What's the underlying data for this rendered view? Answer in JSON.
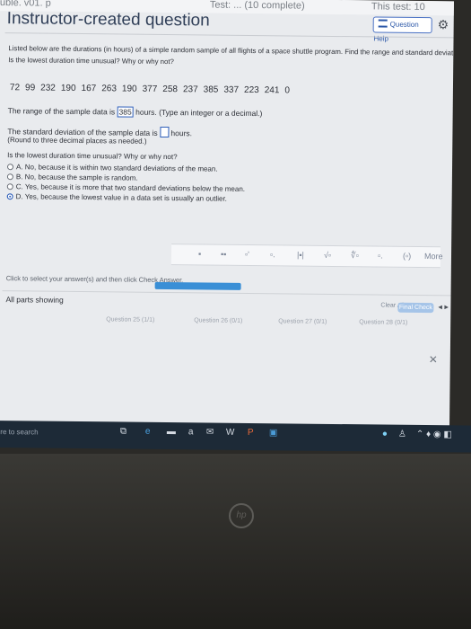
{
  "top": {
    "left": "uble. v01. p",
    "center": "Test: ... (10 complete)",
    "right": "This test: 10"
  },
  "header": {
    "title": "Instructor-created question",
    "help_button": "Question Help"
  },
  "question": {
    "prompt_line1": "Listed below are the durations (in hours) of a simple random sample of all flights of a space shuttle program. Find the range and standard deviation for the sample data.",
    "prompt_line2": "Is the lowest duration time unusual? Why or why not?",
    "data_values": [
      "72",
      "99",
      "232",
      "190",
      "167",
      "263",
      "190",
      "377",
      "258",
      "237",
      "385",
      "337",
      "223",
      "241",
      "0"
    ],
    "range_text_before": "The range of the sample data is",
    "range_value": "385",
    "range_text_after": "hours. (Type an integer or a decimal.)",
    "sd_text_before": "The standard deviation of the sample data is",
    "sd_text_after": "hours.",
    "sd_hint": "(Round to three decimal places as needed.)",
    "unusual_question": "Is the lowest duration time unusual? Why or why not?",
    "options": [
      {
        "letter": "A.",
        "text": "No, because it is within two standard deviations of the mean."
      },
      {
        "letter": "B.",
        "text": "No, because the sample is random."
      },
      {
        "letter": "C.",
        "text": "Yes, because it is more that two standard deviations below the mean."
      },
      {
        "letter": "D.",
        "text": "Yes, because the lowest value in a data set is usually an outlier."
      }
    ],
    "selected_option": "D."
  },
  "instructions": "Click to select your answer(s) and then click Check Answer.",
  "footer": {
    "all_parts": "All parts showing",
    "clear_all": "Clear All",
    "check_answer": "Final Check",
    "progress_fraction": 0.6
  },
  "nav": {
    "q25": "Question 25 (1/1)",
    "q26": "Question 26 (0/1)",
    "q27": "Question 27 (0/1)",
    "q28": "Question 28 (0/1)"
  },
  "taskbar": {
    "search_hint": "ere to search"
  },
  "laptop": {
    "brand": "hp"
  }
}
